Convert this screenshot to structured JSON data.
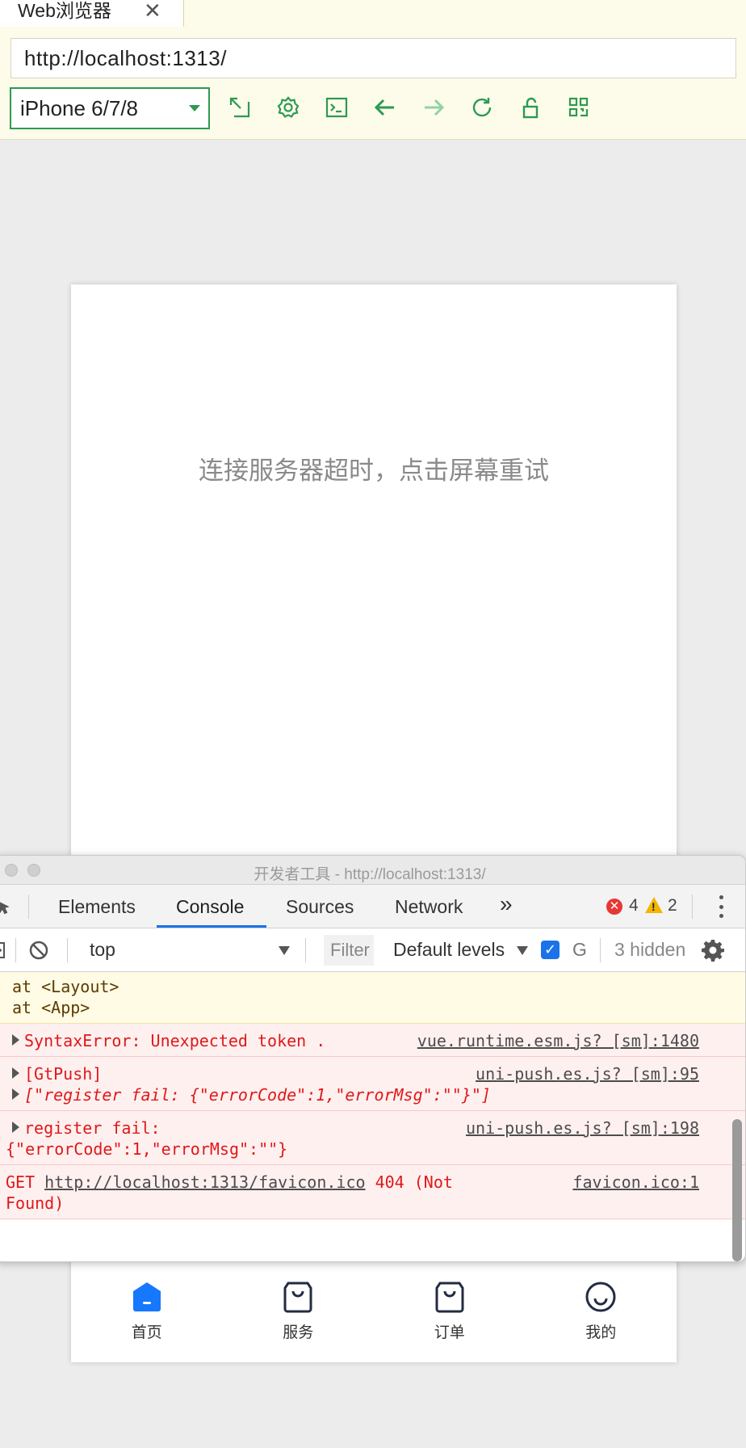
{
  "browser": {
    "tab_title": "Web浏览器",
    "tab_close": "✕",
    "url": "http://localhost:1313/",
    "device": "iPhone 6/7/8",
    "toolbar_icons": [
      "expand-icon",
      "settings-icon",
      "terminal-icon",
      "back-arrow-icon",
      "forward-arrow-icon",
      "refresh-icon",
      "unlock-icon",
      "qrcode-icon"
    ],
    "accent_color": "#2d9a53"
  },
  "phone": {
    "message": "连接服务器超时，点击屏幕重试",
    "tabbar": [
      {
        "label": "首页",
        "icon": "home-icon",
        "active": true
      },
      {
        "label": "服务",
        "icon": "bag-icon"
      },
      {
        "label": "订单",
        "icon": "bag-icon"
      },
      {
        "label": "我的",
        "icon": "smile-icon"
      }
    ],
    "active_color": "#1677ff"
  },
  "devtools": {
    "title": "开发者工具 - http://localhost:1313/",
    "tabs": [
      "Elements",
      "Console",
      "Sources",
      "Network"
    ],
    "more": "»",
    "error_count": "4",
    "warning_count": "2",
    "context": "top",
    "filter_placeholder": "Filter",
    "levels": "Default levels",
    "group_letter": "G",
    "hidden": "3 hidden",
    "warn_lines": [
      "at <Layout>",
      "at <App>"
    ],
    "messages": [
      {
        "text": "SyntaxError: Unexpected token .",
        "source": "vue.runtime.esm.js? [sm]:1480"
      },
      {
        "text": "[GtPush]",
        "source": "uni-push.es.js? [sm]:95",
        "detail": "[\"register fail: {\"errorCode\":1,\"errorMsg\":\"\"}\"]"
      },
      {
        "text": "register fail:",
        "source": "uni-push.es.js? [sm]:198",
        "detail": "{\"errorCode\":1,\"errorMsg\":\"\"}"
      },
      {
        "prefix": "GET",
        "url": "http://localhost:1313/favicon.ico",
        "status": "404 (Not",
        "status2": "Found)",
        "source": "favicon.ico:1"
      }
    ]
  }
}
